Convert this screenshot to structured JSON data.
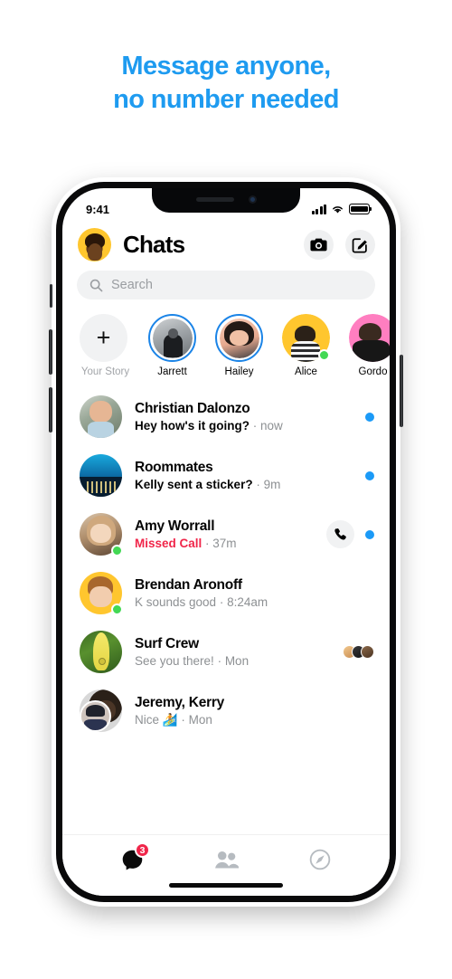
{
  "headline": {
    "line1": "Message anyone,",
    "line2": "no number needed",
    "color": "#1e9bf0"
  },
  "phone": {
    "status_bar": {
      "time": "9:41",
      "signal_icon": "cellular-bars-icon",
      "wifi_icon": "wifi-icon",
      "battery_icon": "battery-full-icon"
    }
  },
  "header": {
    "title": "Chats",
    "avatar_name": "profile-avatar",
    "camera_label": "camera-icon",
    "compose_label": "compose-icon"
  },
  "search": {
    "placeholder": "Search",
    "icon": "search-icon"
  },
  "stories": [
    {
      "label": "Your Story",
      "type": "add",
      "icon": "plus-icon",
      "ring": false,
      "online": false
    },
    {
      "label": "Jarrett",
      "type": "photo",
      "ring": true,
      "online": false,
      "avatar": "av-jarrett"
    },
    {
      "label": "Hailey",
      "type": "photo",
      "ring": true,
      "online": false,
      "avatar": "av-hailey"
    },
    {
      "label": "Alice",
      "type": "photo",
      "ring": false,
      "online": true,
      "avatar": "av-alice"
    },
    {
      "label": "Gordo",
      "type": "photo",
      "ring": false,
      "online": false,
      "avatar": "av-gordon"
    }
  ],
  "chats": [
    {
      "name": "Christian Dalonzo",
      "preview": "Hey how's it going?",
      "separator": " · ",
      "time": "now",
      "unread": true,
      "missed_call": false,
      "avatar": "av-christian",
      "online": false,
      "show_call_button": false,
      "show_seen": false
    },
    {
      "name": "Roommates",
      "preview": "Kelly sent a sticker?",
      "separator": " · ",
      "time": "9m",
      "unread": true,
      "missed_call": false,
      "avatar": "av-roommates",
      "online": false,
      "show_call_button": false,
      "show_seen": false
    },
    {
      "name": "Amy Worrall",
      "preview": "Missed Call",
      "separator": " · ",
      "time": "37m",
      "unread": true,
      "missed_call": true,
      "avatar": "av-amy",
      "online": true,
      "show_call_button": true,
      "show_seen": false
    },
    {
      "name": "Brendan Aronoff",
      "preview": "K sounds good",
      "separator": " · ",
      "time": "8:24am",
      "unread": false,
      "missed_call": false,
      "avatar": "av-brendan",
      "online": true,
      "show_call_button": false,
      "show_seen": false
    },
    {
      "name": "Surf Crew",
      "preview": "See you there!",
      "separator": " · ",
      "time": "Mon",
      "unread": false,
      "missed_call": false,
      "avatar": "av-surf",
      "online": false,
      "show_call_button": false,
      "show_seen": true
    },
    {
      "name": "Jeremy, Kerry",
      "preview": "Nice 🏄",
      "separator": " · ",
      "time": "Mon",
      "unread": false,
      "missed_call": false,
      "avatar": "av-jeremy",
      "online": false,
      "show_call_button": false,
      "show_seen": false
    }
  ],
  "tabs": [
    {
      "name": "chats-tab",
      "icon": "chat-bubble-icon",
      "badge": "3",
      "active": true
    },
    {
      "name": "people-tab",
      "icon": "people-icon",
      "badge": "",
      "active": false
    },
    {
      "name": "discover-tab",
      "icon": "compass-icon",
      "badge": "",
      "active": false
    }
  ],
  "colors": {
    "accent_blue": "#1b9af7",
    "headline_blue": "#1e9bf0",
    "missed_red": "#f0264a",
    "online_green": "#43d854",
    "badge_red": "#f0264a"
  }
}
